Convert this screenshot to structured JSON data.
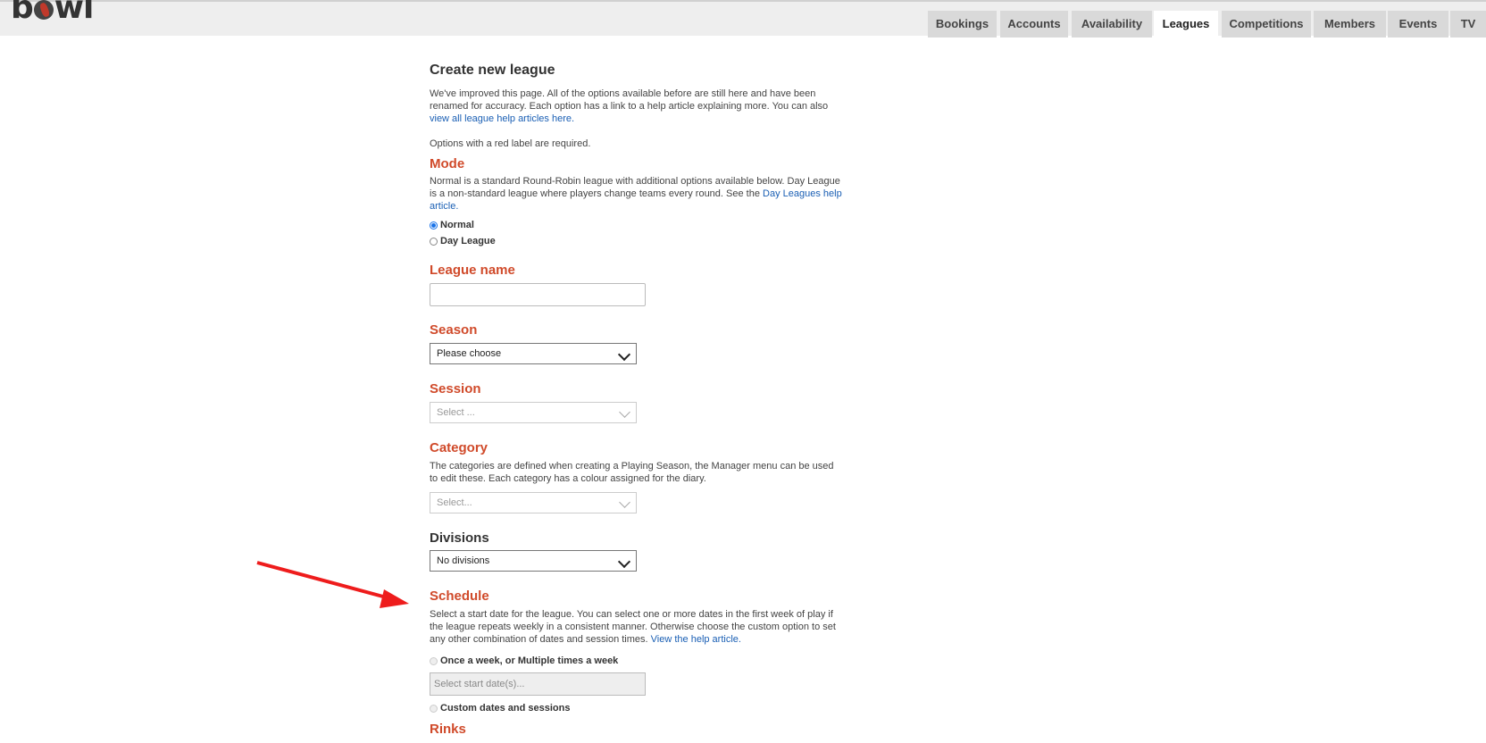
{
  "header": {
    "logo_text": "bowl",
    "tabs": [
      {
        "label": "Bookings",
        "active": false
      },
      {
        "label": "Accounts",
        "active": false
      },
      {
        "label": "Availability",
        "active": false
      },
      {
        "label": "Leagues",
        "active": true
      },
      {
        "label": "Competitions",
        "active": false
      },
      {
        "label": "Members",
        "active": false
      },
      {
        "label": "Events",
        "active": false
      },
      {
        "label": "TV",
        "active": false
      }
    ]
  },
  "page": {
    "title": "Create new league",
    "intro_text": "We've improved this page. All of the options available before are still here and have been renamed for accuracy. Each option has a link to a help article explaining more. You can also",
    "intro_link": "view all league help articles here.",
    "required_note": "Options with a red label are required."
  },
  "mode": {
    "label": "Mode",
    "description": "Normal is a standard Round-Robin league with additional options available below. Day League is a non-standard league where players change teams every round. See the",
    "link": "Day Leagues help article.",
    "options": [
      {
        "label": "Normal",
        "checked": true
      },
      {
        "label": "Day League",
        "checked": false
      }
    ]
  },
  "league_name": {
    "label": "League name",
    "value": ""
  },
  "season": {
    "label": "Season",
    "selected": "Please choose"
  },
  "session": {
    "label": "Session",
    "placeholder": "Select ..."
  },
  "category": {
    "label": "Category",
    "description": "The categories are defined when creating a Playing Season, the Manager menu can be used to edit these. Each category has a colour assigned for the diary.",
    "placeholder": "Select..."
  },
  "divisions": {
    "label": "Divisions",
    "selected": "No divisions"
  },
  "schedule": {
    "label": "Schedule",
    "description": "Select a start date for the league. You can select one or more dates in the first week of play if the league repeats weekly in a consistent manner. Otherwise choose the custom option to set any other combination of dates and session times.",
    "link": "View the help article.",
    "option_weekly": "Once a week, or Multiple times a week",
    "date_placeholder": "Select start date(s)...",
    "option_custom": "Custom dates and sessions"
  },
  "rinks": {
    "label": "Rinks"
  },
  "colors": {
    "required_label": "#d04a2a",
    "link": "#1a5fb4",
    "annotation_arrow": "#ee1c1c"
  }
}
